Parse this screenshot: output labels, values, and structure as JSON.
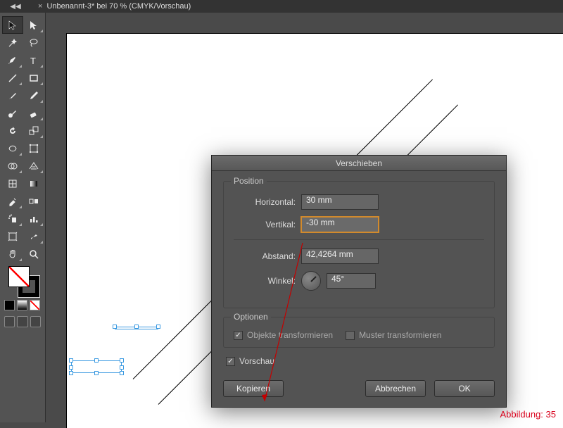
{
  "tab": {
    "collapse": "◀◀",
    "close": "×",
    "title": "Unbenannt-3* bei 70 % (CMYK/Vorschau)"
  },
  "dialog": {
    "title": "Verschieben",
    "group_position": "Position",
    "horizontal_label": "Horizontal:",
    "horizontal_value": "30 mm",
    "vertical_label": "Vertikal:",
    "vertical_value": "-30 mm",
    "distance_label": "Abstand:",
    "distance_value": "42,4264 mm",
    "angle_label": "Winkel:",
    "angle_value": "45°",
    "group_options": "Optionen",
    "transform_objects": "Objekte transformieren",
    "transform_patterns": "Muster transformieren",
    "preview": "Vorschau",
    "copy": "Kopieren",
    "cancel": "Abbrechen",
    "ok": "OK"
  },
  "caption": "Abbildung: 35",
  "tools": [
    "selection",
    "direct-selection",
    "magic-wand",
    "lasso",
    "pen",
    "type",
    "line-segment",
    "rectangle",
    "paintbrush",
    "pencil",
    "blob-brush",
    "eraser",
    "rotate",
    "scale",
    "width",
    "free-transform",
    "shape-builder",
    "perspective-grid",
    "mesh",
    "gradient",
    "eyedropper",
    "blend",
    "symbol-sprayer",
    "column-graph",
    "artboard",
    "slice",
    "hand",
    "zoom"
  ]
}
